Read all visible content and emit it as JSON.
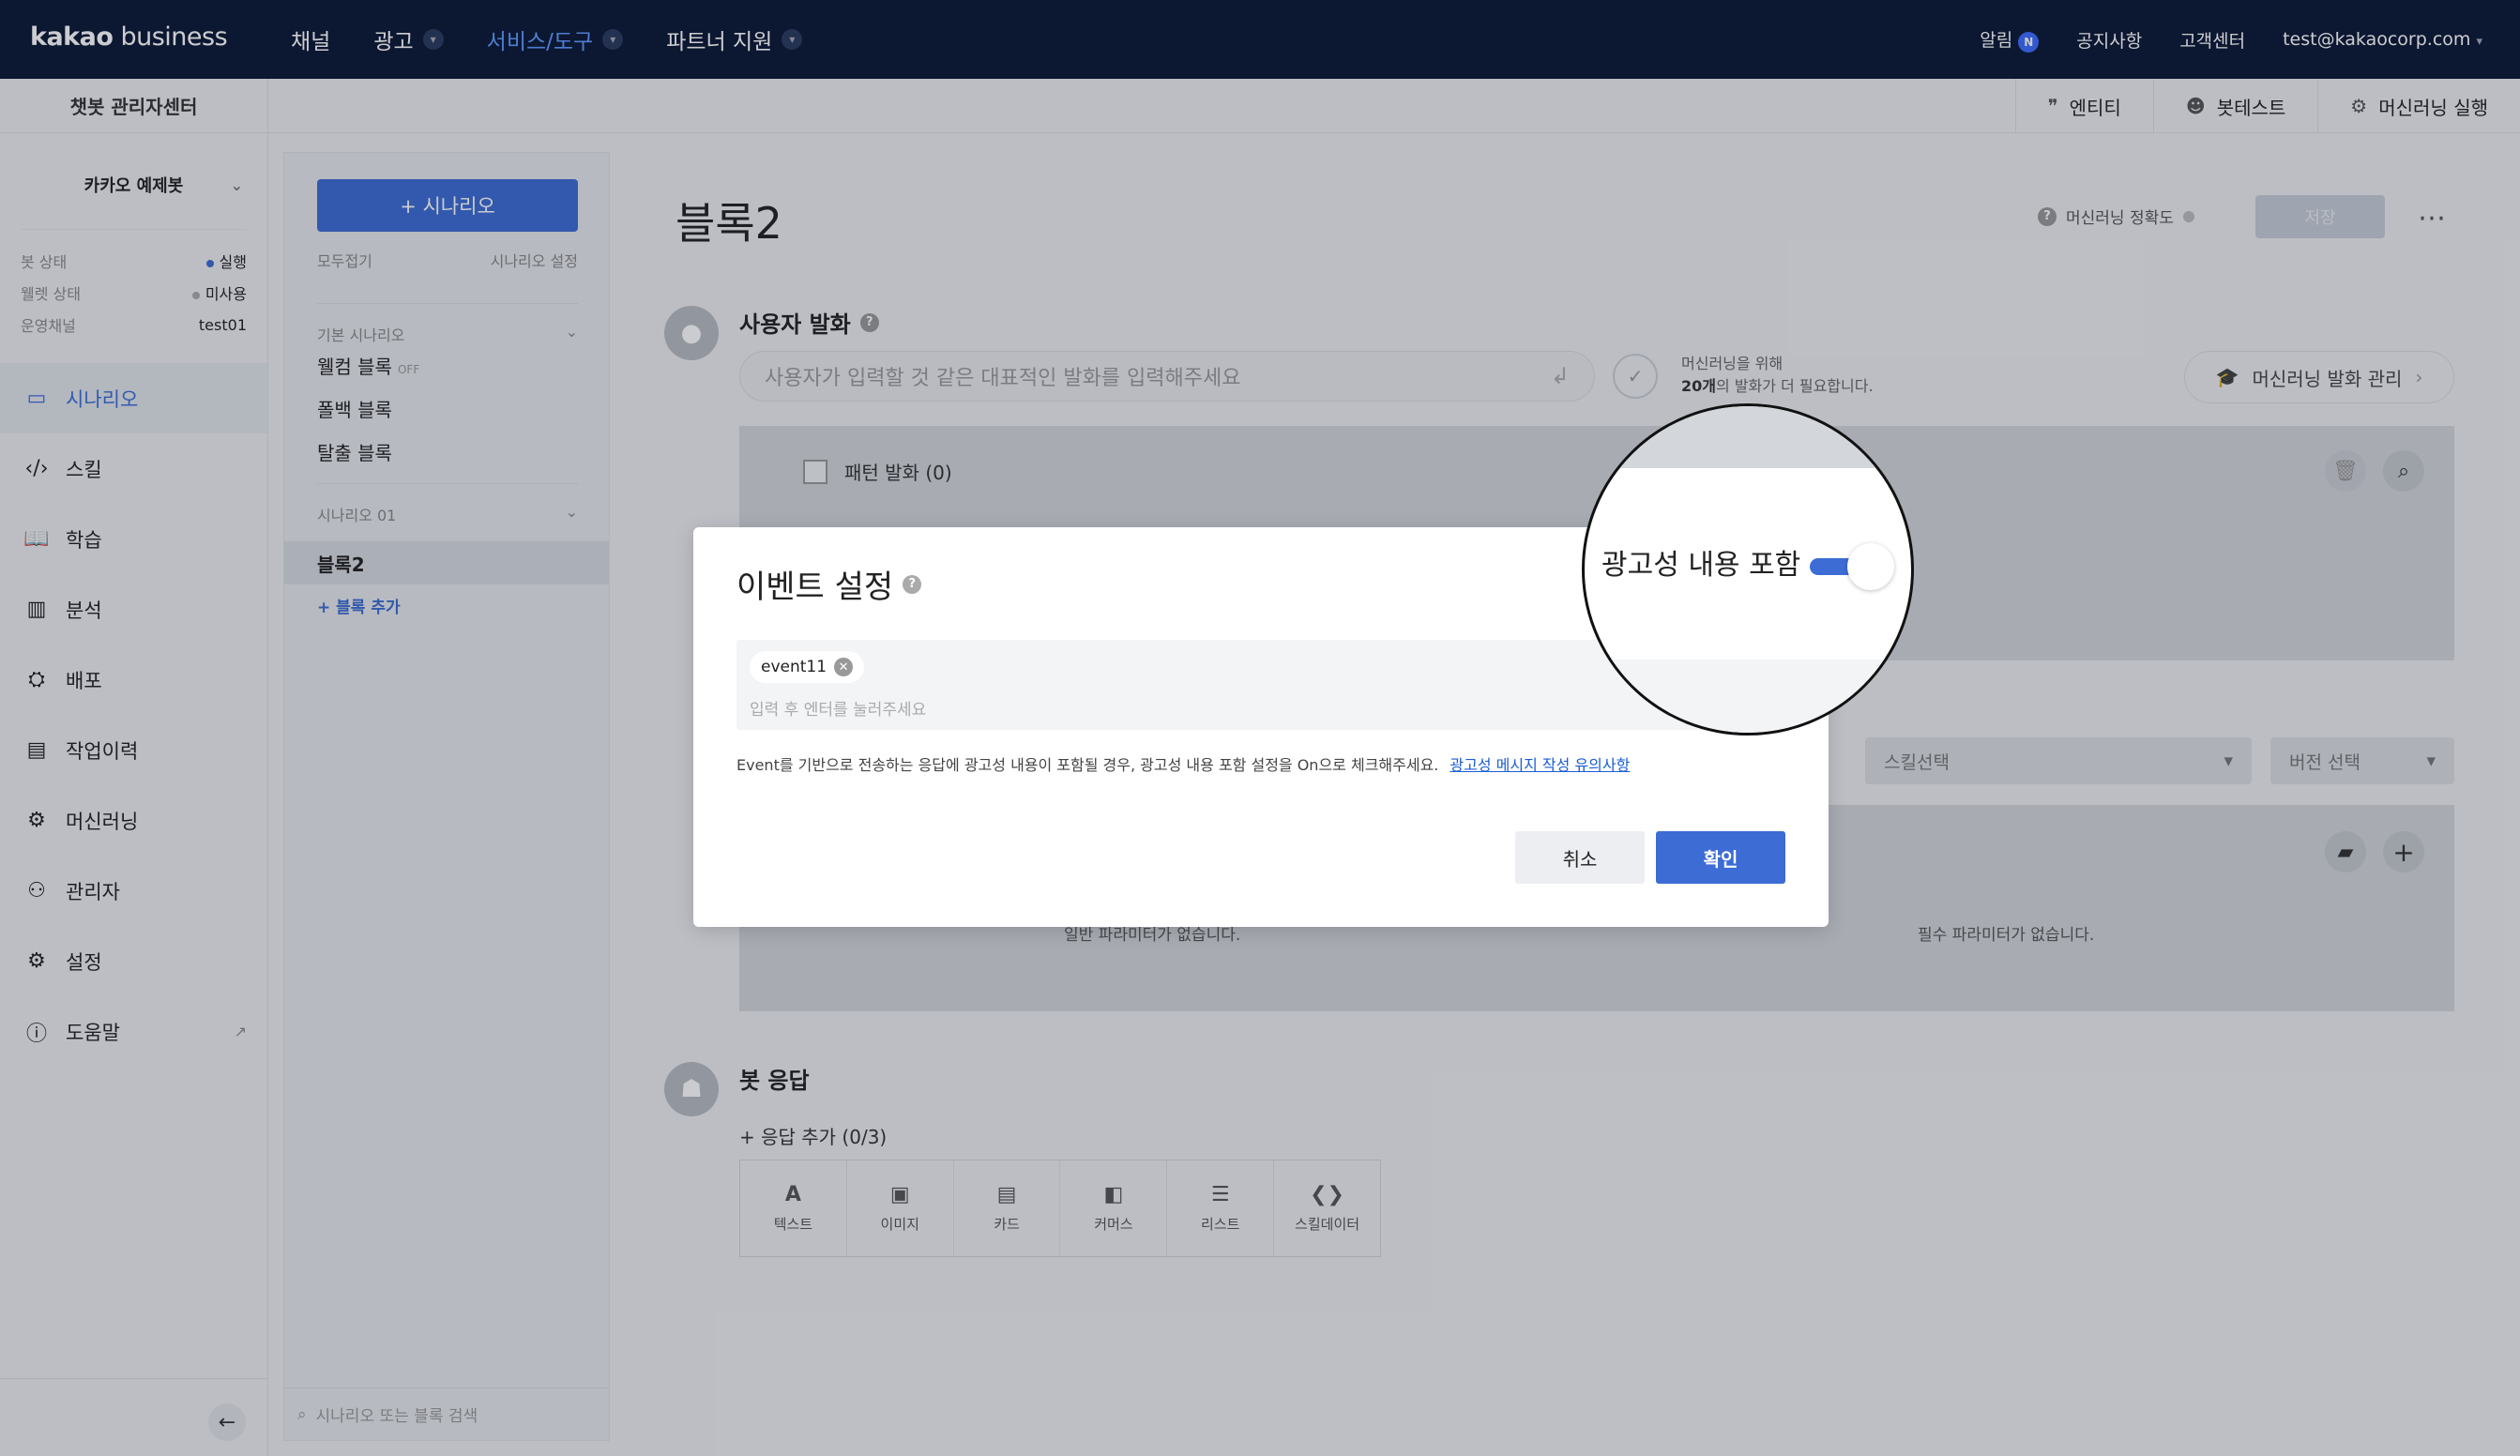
{
  "topnav": {
    "logo_bold": "kakao",
    "logo_light": " business",
    "items": [
      {
        "label": "채널"
      },
      {
        "label": "광고"
      },
      {
        "label": "서비스/도구"
      },
      {
        "label": "파트너 지원"
      }
    ],
    "notifications": "알림",
    "notifications_badge": "N",
    "notice": "공지사항",
    "support": "고객센터",
    "account": "test@kakaocorp.com"
  },
  "sidebar": {
    "title": "챗봇 관리자센터",
    "bot_name": "카카오 예제봇",
    "status": [
      {
        "label": "봇 상태",
        "value": "실행",
        "color": "#3c6cd4"
      },
      {
        "label": "웰렛 상태",
        "value": "미사용",
        "color": "#aaaaaa"
      },
      {
        "label": "운영채널",
        "value": "test01"
      }
    ],
    "menu": [
      {
        "label": "시나리오",
        "icon": "scenario-icon"
      },
      {
        "label": "스킬",
        "icon": "code-icon"
      },
      {
        "label": "학습",
        "icon": "book-icon"
      },
      {
        "label": "분석",
        "icon": "chart-icon"
      },
      {
        "label": "배포",
        "icon": "deploy-icon"
      },
      {
        "label": "작업이력",
        "icon": "history-icon"
      },
      {
        "label": "머신러닝",
        "icon": "chip-icon"
      },
      {
        "label": "관리자",
        "icon": "user-icon"
      },
      {
        "label": "설정",
        "icon": "gear-icon"
      },
      {
        "label": "도움말",
        "icon": "help-icon"
      }
    ]
  },
  "subheader": {
    "entity": "엔티티",
    "bot_test": "봇테스트",
    "ml_run": "머신러닝 실행"
  },
  "scenario_panel": {
    "add_button": "+ 시나리오",
    "collapse_all": "모두접기",
    "scenario_settings": "시나리오 설정",
    "default_section": "기본 시나리오",
    "welcome_block": "웰컴 블록",
    "welcome_off": "OFF",
    "fallback_block": "폴백 블록",
    "exit_block": "탈출 블록",
    "scenario_01": "시나리오 01",
    "block2": "블록2",
    "add_block": "+ 블록 추가",
    "search_placeholder": "시나리오 또는 블록 검색"
  },
  "main": {
    "block_title": "블록2",
    "ml_accuracy": "머신러닝 정확도",
    "save": "저장",
    "user_utterance": "사용자 발화",
    "utterance_placeholder": "사용자가 입력할 것 같은 대표적인 발화를 입력해주세요",
    "ml_need_line1": "머신러닝을 위해",
    "ml_need_count": "20개",
    "ml_need_line2": "의 발화가 더 필요합니다.",
    "ml_manage": "머신러닝 발화 관리",
    "pattern_label": "패턴 발화 (0)",
    "select_placeholder": "스킬선택",
    "version_placeholder": "버전 선택",
    "param_empty_general": "일반 파라미터가 없습니다.",
    "param_empty_required": "필수 파라미터가 없습니다.",
    "bot_response": "봇 응답",
    "add_response": "+ 응답 추가 (0/3)",
    "response_types": [
      {
        "label": "텍스트",
        "icon": "text-icon",
        "glyph": "A"
      },
      {
        "label": "이미지",
        "icon": "image-icon",
        "glyph": "▣"
      },
      {
        "label": "카드",
        "icon": "card-icon",
        "glyph": "▤"
      },
      {
        "label": "커머스",
        "icon": "commerce-icon",
        "glyph": "◧"
      },
      {
        "label": "리스트",
        "icon": "list-icon",
        "glyph": "☰"
      },
      {
        "label": "스킬데이터",
        "icon": "skill-data-icon",
        "glyph": "❮❯"
      }
    ]
  },
  "modal": {
    "title": "이벤트 설정",
    "tag": "event11",
    "tag_placeholder": "입력 후 엔터를 눌러주세요",
    "notice": "Event를 기반으로 전송하는 응답에 광고성 내용이 포함될 경우, 광고성 내용 포함 설정을 On으로 체크해주세요.",
    "notice_link": "광고성 메시지 작성 유의사항",
    "cancel": "취소",
    "confirm": "확인",
    "ad_toggle_label": "광고성 내용 포함",
    "ad_toggle_on": true
  },
  "colors": {
    "nav_bg": "#0b1836",
    "accent": "#3c6cd4",
    "nav_active": "#5e9bff"
  }
}
